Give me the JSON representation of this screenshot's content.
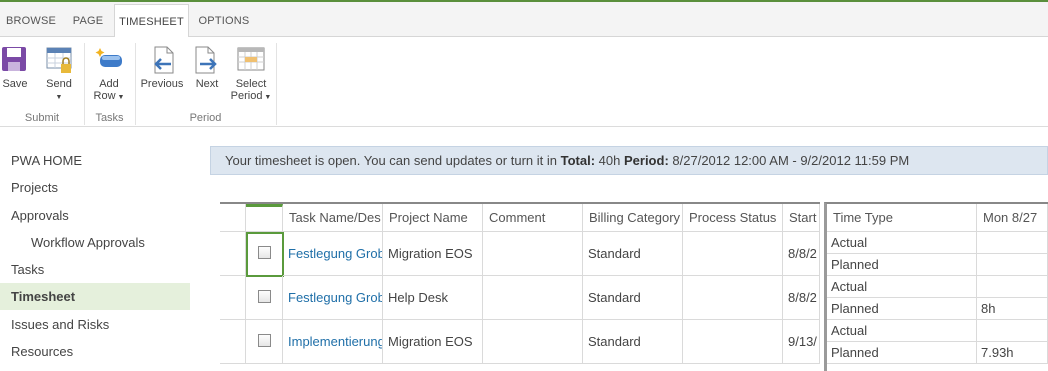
{
  "tabs": [
    {
      "label": "BROWSE"
    },
    {
      "label": "PAGE"
    },
    {
      "label": "TIMESHEET"
    },
    {
      "label": "OPTIONS"
    }
  ],
  "ribbon": {
    "save": "Save",
    "send": "Send",
    "add_row_1": "Add",
    "add_row_2": "Row",
    "previous": "Previous",
    "next": "Next",
    "select_period_1": "Select",
    "select_period_2": "Period",
    "groups": {
      "submit": "Submit",
      "tasks": "Tasks",
      "period": "Period"
    }
  },
  "nav": [
    {
      "label": "PWA HOME"
    },
    {
      "label": "Projects"
    },
    {
      "label": "Approvals"
    },
    {
      "label": "Workflow Approvals"
    },
    {
      "label": "Tasks"
    },
    {
      "label": "Timesheet"
    },
    {
      "label": "Issues and Risks"
    },
    {
      "label": "Resources"
    }
  ],
  "status": {
    "text": "Your timesheet is open. You can send updates or turn it in",
    "total_label": "Total:",
    "total_value": "40h",
    "period_label": "Period:",
    "period_value": "8/27/2012 12:00 AM - 9/2/2012 11:59 PM"
  },
  "grid": {
    "headers": [
      "Task Name/Des",
      "Project Name",
      "Comment",
      "Billing Category",
      "Process Status",
      "Start"
    ],
    "rows": [
      {
        "task": "Festlegung Grob",
        "project": "Migration EOS",
        "comment": "",
        "billing": "Standard",
        "process": "",
        "start": "8/8/2"
      },
      {
        "task": "Festlegung Grob",
        "project": "Help Desk",
        "comment": "",
        "billing": "Standard",
        "process": "",
        "start": "8/8/2"
      },
      {
        "task": "Implementierung",
        "project": "Migration EOS",
        "comment": "",
        "billing": "Standard",
        "process": "",
        "start": "9/13/"
      }
    ]
  },
  "timegrid": {
    "headers": [
      "Time Type",
      "Mon 8/27"
    ],
    "rows": [
      {
        "type": "Actual",
        "mon": ""
      },
      {
        "type": "Planned",
        "mon": ""
      },
      {
        "type": "Actual",
        "mon": ""
      },
      {
        "type": "Planned",
        "mon": "8h"
      },
      {
        "type": "Actual",
        "mon": ""
      },
      {
        "type": "Planned",
        "mon": "7.93h"
      }
    ]
  },
  "colors": {
    "accent": "#5a8f3c",
    "link": "#1f6fa8",
    "status_bg": "#dde6f0",
    "nav_selected": "#e5f0dc"
  }
}
